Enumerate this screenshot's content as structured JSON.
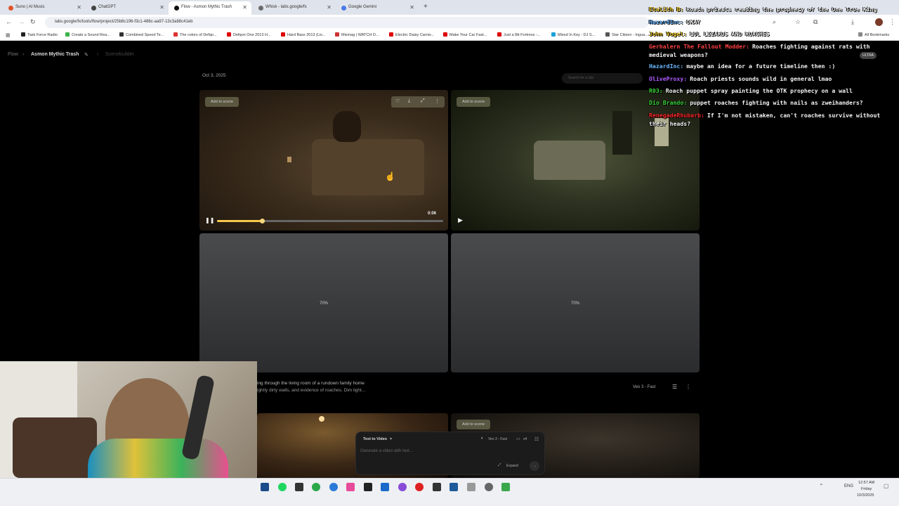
{
  "browser": {
    "tabs": [
      {
        "label": "Suno | AI Music",
        "color": "#e0542c"
      },
      {
        "label": "ChatGPT",
        "color": "#444444"
      },
      {
        "label": "Flow - Asmon Mythic Trash",
        "color": "#111111",
        "active": true
      },
      {
        "label": "Whisk - labs.google/fx",
        "color": "#6a6a6a"
      },
      {
        "label": "Google Gemini",
        "color": "#4a7ae8"
      }
    ],
    "url": "labs.google/fx/tools/flow/project/25b8c196-f3c1-486c-aa97-13c3a88c41eb",
    "bookmarks": [
      {
        "label": "Task Force Radio",
        "color": "#222222"
      },
      {
        "label": "Create a Sound Rea...",
        "color": "#3bb34a"
      },
      {
        "label": "Combined Speed Te...",
        "color": "#333333"
      },
      {
        "label": "The colors of Defqo...",
        "color": "#d33"
      },
      {
        "label": "Defqon One 2013 H...",
        "color": "#d00"
      },
      {
        "label": "Hard Bass 2013 (Liv...",
        "color": "#d00"
      },
      {
        "label": "Mixmag | WATCH D...",
        "color": "#c33"
      },
      {
        "label": "Electric Daisy Carniv...",
        "color": "#d00"
      },
      {
        "label": "Make Your Car Fast...",
        "color": "#d00"
      },
      {
        "label": "Just a Bit Fortress -...",
        "color": "#d00"
      },
      {
        "label": "Mixed In Key - DJ S...",
        "color": "#1aa0d8"
      },
      {
        "label": "Star Citizen - Ingua...",
        "color": "#555555"
      }
    ],
    "all_bookmarks": "All Bookmarks",
    "ultra_badge": "ULTRA"
  },
  "flow": {
    "breadcrumb_root": "Flow",
    "project_title": "Asmon Mythic Trash",
    "breadcrumb_section": "Scenebuilder",
    "date": "Oct 3, 2025",
    "search_placeholder": "Search for a clip",
    "add_to_scene": "Add to scene",
    "video_time": "0:06",
    "progress_fraction": 0.2,
    "pending_percent_1": "70%",
    "pending_percent_2": "70%",
    "prompt_line1": "ing through the living room of a rundown family home",
    "prompt_line2": "ightly dirty walls, and evidence of roaches. Dim light...",
    "model_label": "Veo 3 - Fast",
    "composer": {
      "mode": "Text to Video",
      "placeholder": "Generate a video with text...",
      "model": "Veo 3 - Fast",
      "count": "x4",
      "expand": "Expand"
    }
  },
  "chat": [
    {
      "user": "Etalith B:",
      "color": "#f5d033",
      "msg": "Roach priests reading the prophecy of the One True King"
    },
    {
      "user": "HazardInc:",
      "color": "#6bb8ff",
      "msg": "OKAY"
    },
    {
      "user": "John Vogel:",
      "color": "#f5d033",
      "msg": "LOL LIZARDS AND ROACHES"
    },
    {
      "user": "Gerhalern The Fallout Modder:",
      "color": "#ff4040",
      "msg": "Roaches fighting against rats with medieval weapons?"
    },
    {
      "user": "HazardInc:",
      "color": "#6bb8ff",
      "msg": "maybe an idea for a future timeline then :)"
    },
    {
      "user": "OliveProxy:",
      "color": "#b05cff",
      "msg": "Roach priests sounds wild in general lmao"
    },
    {
      "user": "R03:",
      "color": "#3bd63b",
      "msg": "Roach puppet spray painting the OTK prophecy on a wall"
    },
    {
      "user": "Dio Brando:",
      "color": "#3bd63b",
      "msg": "puppet roaches fighting with nails as zweihanders?"
    },
    {
      "user": "RenegadeRhubarb:",
      "color": "#ff2a2a",
      "msg": "If I'm not mistaken, can't roaches survive without their heads?"
    }
  ],
  "taskbar": {
    "time": "12:57 AM",
    "day": "Friday",
    "date": "10/3/2025",
    "lang": "ENG"
  }
}
